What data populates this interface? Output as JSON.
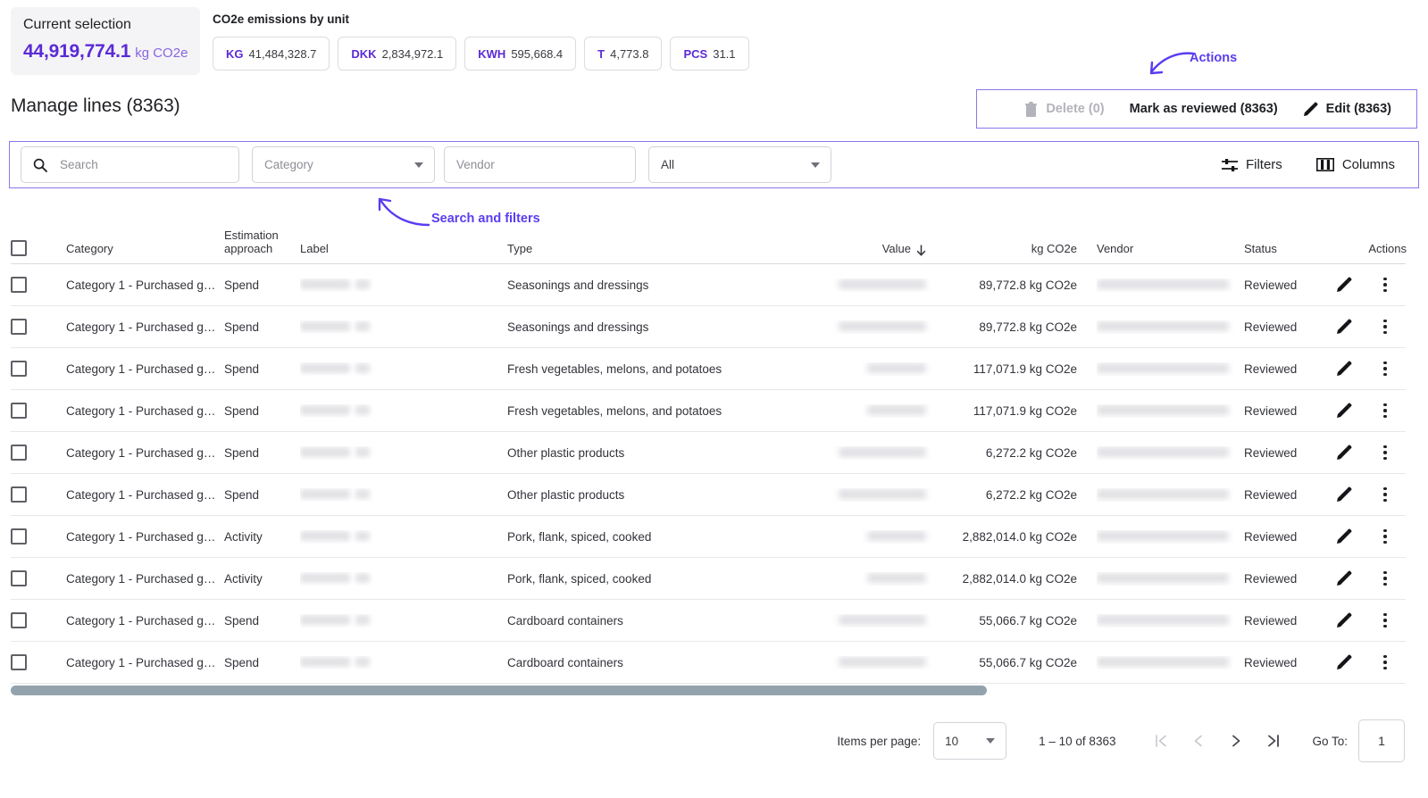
{
  "summary": {
    "current_selection_title": "Current selection",
    "current_selection_value": "44,919,774.1",
    "current_selection_unit": "kg CO2e",
    "units_title": "CO2e emissions by unit",
    "unit_chips": [
      {
        "unit": "KG",
        "value": "41,484,328.7"
      },
      {
        "unit": "DKK",
        "value": "2,834,972.1"
      },
      {
        "unit": "KWH",
        "value": "595,668.4"
      },
      {
        "unit": "T",
        "value": "4,773.8"
      },
      {
        "unit": "PCS",
        "value": "31.1"
      }
    ]
  },
  "annotations": {
    "actions": "Actions",
    "search_and_filters": "Search and filters"
  },
  "header": {
    "page_title": "Manage lines (8363)"
  },
  "action_bar": {
    "delete_label": "Delete (0)",
    "mark_reviewed_label": "Mark as reviewed (8363)",
    "edit_label": "Edit (8363)"
  },
  "filter_bar": {
    "search_placeholder": "Search",
    "category_placeholder": "Category",
    "vendor_placeholder": "Vendor",
    "all_value": "All",
    "filters_label": "Filters",
    "columns_label": "Columns"
  },
  "table": {
    "columns": [
      "Category",
      "Estimation approach",
      "Label",
      "Type",
      "Value",
      "kg CO2e",
      "Vendor",
      "Status",
      "Actions"
    ],
    "sort": {
      "column": "Value",
      "direction": "desc"
    },
    "rows": [
      {
        "category": "Category 1 - Purchased g…",
        "estimation": "Spend",
        "type": "Seasonings and dressings",
        "co2e": "89,772.8 kg CO2e",
        "status": "Reviewed"
      },
      {
        "category": "Category 1 - Purchased g…",
        "estimation": "Spend",
        "type": "Seasonings and dressings",
        "co2e": "89,772.8 kg CO2e",
        "status": "Reviewed"
      },
      {
        "category": "Category 1 - Purchased g…",
        "estimation": "Spend",
        "type": "Fresh vegetables, melons, and potatoes",
        "co2e": "117,071.9 kg CO2e",
        "status": "Reviewed"
      },
      {
        "category": "Category 1 - Purchased g…",
        "estimation": "Spend",
        "type": "Fresh vegetables, melons, and potatoes",
        "co2e": "117,071.9 kg CO2e",
        "status": "Reviewed"
      },
      {
        "category": "Category 1 - Purchased g…",
        "estimation": "Spend",
        "type": "Other plastic products",
        "co2e": "6,272.2 kg CO2e",
        "status": "Reviewed"
      },
      {
        "category": "Category 1 - Purchased g…",
        "estimation": "Spend",
        "type": "Other plastic products",
        "co2e": "6,272.2 kg CO2e",
        "status": "Reviewed"
      },
      {
        "category": "Category 1 - Purchased g…",
        "estimation": "Activity",
        "type": "Pork, flank, spiced, cooked",
        "co2e": "2,882,014.0 kg CO2e",
        "status": "Reviewed"
      },
      {
        "category": "Category 1 - Purchased g…",
        "estimation": "Activity",
        "type": "Pork, flank, spiced, cooked",
        "co2e": "2,882,014.0 kg CO2e",
        "status": "Reviewed"
      },
      {
        "category": "Category 1 - Purchased g…",
        "estimation": "Spend",
        "type": "Cardboard containers",
        "co2e": "55,066.7 kg CO2e",
        "status": "Reviewed"
      },
      {
        "category": "Category 1 - Purchased g…",
        "estimation": "Spend",
        "type": "Cardboard containers",
        "co2e": "55,066.7 kg CO2e",
        "status": "Reviewed"
      }
    ]
  },
  "pagination": {
    "items_per_page_label": "Items per page:",
    "items_per_page_value": "10",
    "range_label": "1 – 10 of 8363",
    "goto_label": "Go To:",
    "goto_value": "1"
  },
  "colors": {
    "accent_purple": "#5b2ad6",
    "annotation_purple": "#5b3cf0",
    "scrollbar": "#93a3ad"
  }
}
